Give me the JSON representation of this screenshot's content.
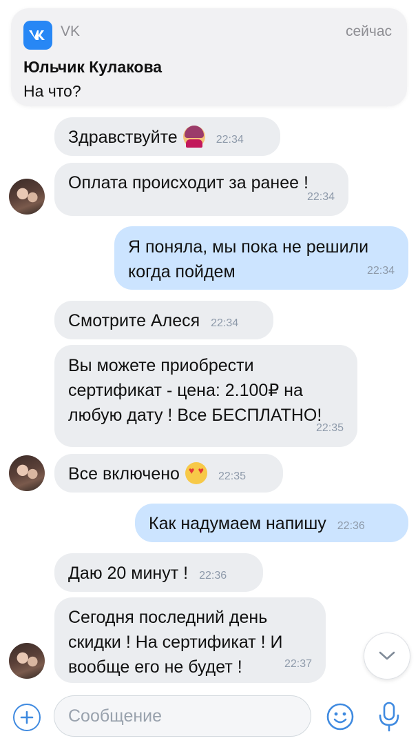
{
  "notification": {
    "app_name": "VK",
    "time": "сейчас",
    "sender": "Юльчик Кулакова",
    "preview": "На что?",
    "icon": "vk-logo-icon"
  },
  "messages": [
    {
      "direction": "in",
      "text": "Здравствуйте",
      "emoji": "woman-raising-hand-emoji",
      "time": "22:34"
    },
    {
      "direction": "in",
      "text": "Оплата происходит за ранее !",
      "time": "22:34",
      "avatar": true
    },
    {
      "direction": "out",
      "text": "Я поняла, мы пока не решили\nкогда пойдем",
      "time": "22:34"
    },
    {
      "direction": "in",
      "text": "Смотрите Алеся",
      "time": "22:34"
    },
    {
      "direction": "in",
      "text": "Вы можете приобрести\nсертификат - цена: 2.100₽ на\nлюбую дату ! Все БЕСПЛАТНО!",
      "time": "22:35"
    },
    {
      "direction": "in",
      "text": "Все включено",
      "emoji": "heart-eyes-emoji",
      "time": "22:35",
      "avatar": true
    },
    {
      "direction": "out",
      "text": "Как надумаем напишу",
      "time": "22:36"
    },
    {
      "direction": "in",
      "text": "Даю 20 минут !",
      "time": "22:36"
    },
    {
      "direction": "in",
      "text": "Сегодня последний день\nскидки ! На сертификат ! И\nвообще его не будет !",
      "time": "22:37",
      "avatar": true
    }
  ],
  "composer": {
    "placeholder": "Сообщение",
    "value": "",
    "icons": [
      "plus-icon",
      "emoji-icon",
      "microphone-icon"
    ]
  },
  "scroll_button": {
    "icon": "chevron-down-icon"
  },
  "colors": {
    "incoming_bubble": "#ebedf0",
    "outgoing_bubble": "#cce4ff",
    "accent": "#3f8ae0",
    "vk_blue": "#2787f5",
    "timestamp": "#8e9aaa"
  }
}
